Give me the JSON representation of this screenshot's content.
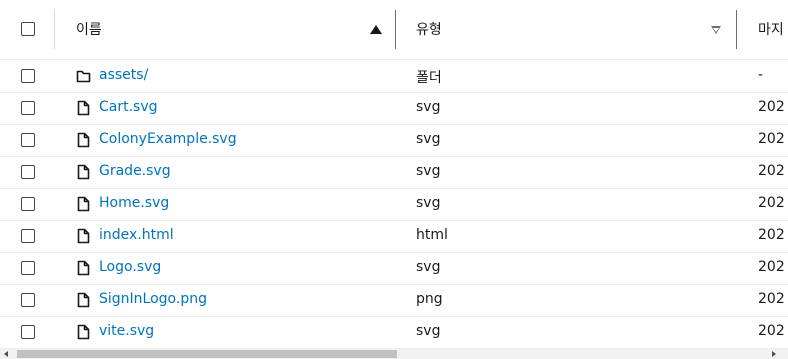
{
  "columns": {
    "name": "이름",
    "type": "유형",
    "modified": "마지"
  },
  "colors": {
    "link": "#0073bb",
    "text": "#16191f",
    "border": "#eaeded"
  },
  "rows": [
    {
      "name": "assets/",
      "icon": "folder-icon",
      "type": "폴더",
      "modified": "-"
    },
    {
      "name": "Cart.svg",
      "icon": "file-icon",
      "type": "svg",
      "modified": "202"
    },
    {
      "name": "ColonyExample.svg",
      "icon": "file-icon",
      "type": "svg",
      "modified": "202"
    },
    {
      "name": "Grade.svg",
      "icon": "file-icon",
      "type": "svg",
      "modified": "202"
    },
    {
      "name": "Home.svg",
      "icon": "file-icon",
      "type": "svg",
      "modified": "202"
    },
    {
      "name": "index.html",
      "icon": "file-icon",
      "type": "html",
      "modified": "202"
    },
    {
      "name": "Logo.svg",
      "icon": "file-icon",
      "type": "svg",
      "modified": "202"
    },
    {
      "name": "SignInLogo.png",
      "icon": "file-icon",
      "type": "png",
      "modified": "202"
    },
    {
      "name": "vite.svg",
      "icon": "file-icon",
      "type": "svg",
      "modified": "202"
    }
  ]
}
